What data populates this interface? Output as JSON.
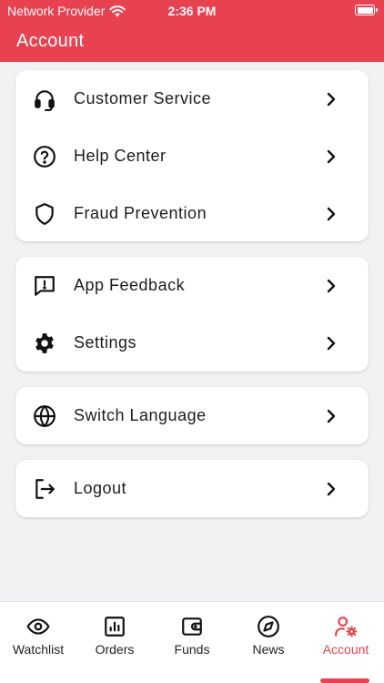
{
  "status_bar": {
    "carrier": "Network Provider",
    "time": "2:36 PM"
  },
  "header": {
    "title": "Account"
  },
  "groups": [
    {
      "items": [
        {
          "label": "Customer Service",
          "icon": "headset-icon"
        },
        {
          "label": "Help Center",
          "icon": "help-circle-icon"
        },
        {
          "label": "Fraud Prevention",
          "icon": "shield-icon"
        }
      ]
    },
    {
      "items": [
        {
          "label": "App Feedback",
          "icon": "feedback-icon"
        },
        {
          "label": "Settings",
          "icon": "gear-icon"
        }
      ]
    },
    {
      "items": [
        {
          "label": "Switch Language",
          "icon": "globe-icon"
        }
      ]
    },
    {
      "items": [
        {
          "label": "Logout",
          "icon": "logout-icon"
        }
      ]
    }
  ],
  "tabs": [
    {
      "label": "Watchlist",
      "icon": "eye-icon"
    },
    {
      "label": "Orders",
      "icon": "bar-chart-icon"
    },
    {
      "label": "Funds",
      "icon": "wallet-icon"
    },
    {
      "label": "News",
      "icon": "compass-icon"
    },
    {
      "label": "Account",
      "icon": "user-settings-icon",
      "active": true
    }
  ],
  "colors": {
    "accent": "#e8414f",
    "background": "#f2f2f4",
    "card": "#ffffff"
  }
}
